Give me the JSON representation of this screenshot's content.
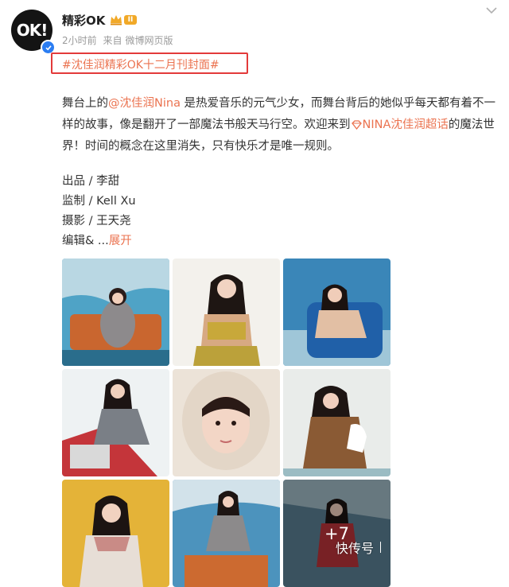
{
  "post": {
    "avatar_text": "OK!",
    "username": "精彩OK",
    "vip_level": "II",
    "time": "2小时前",
    "source_prefix": "来自",
    "source": "微博网页版",
    "hashtag": "#沈佳润精彩OK十二月刊封面#",
    "body": {
      "p1_before": "舞台上的",
      "mention": "@沈佳润Nina",
      "p1_after": " 是热爱音乐的元气少女，而舞台背后的她似乎每天都有着不一样的故事，像是翻开了一部魔法书般天马行空。欢迎来到",
      "super_topic": "NINA沈佳润超话",
      "p1_end": "的魔法世界！时间的概念在这里消失，只有快乐才是唯一规则。"
    },
    "credits": [
      "出品 / 李甜",
      "监制 / Kell Xu",
      "摄影 / 王天尧"
    ],
    "credits_truncated": "编辑& ...",
    "expand_label": "展开",
    "more_count": "+7",
    "watermark": "快传号"
  },
  "icons": {
    "verified": "verified-badge-icon",
    "vip": "crown-icon",
    "more": "chevron-down-icon",
    "super_topic": "diamond-icon"
  },
  "colors": {
    "link": "#eb7350",
    "highlight_box": "#e33a3a",
    "verified": "#2b7df2"
  }
}
